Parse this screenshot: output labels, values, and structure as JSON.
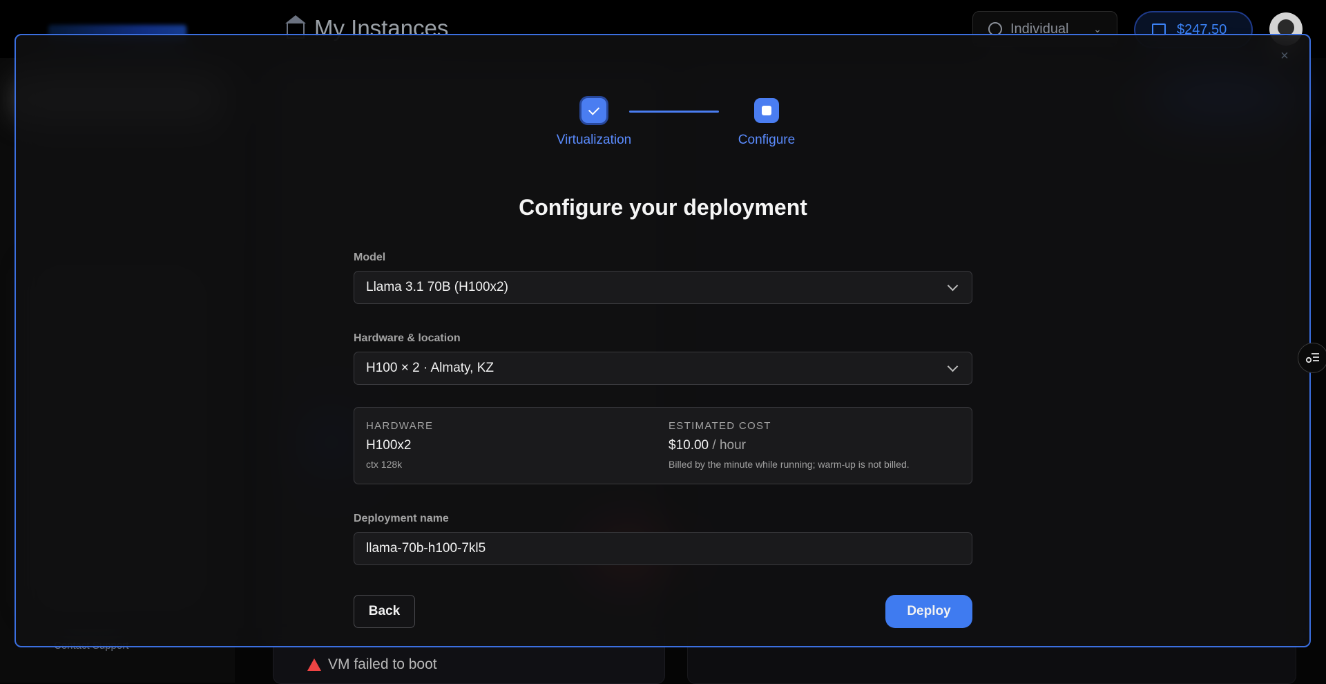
{
  "background": {
    "page_title": "My Instances",
    "account_selector": "Individual",
    "balance": "$247.50",
    "sidebar_footer_link": "Contact Support",
    "instance_error": "VM failed to boot"
  },
  "modal": {
    "close_label": "×",
    "steps": [
      {
        "label": "Virtualization",
        "state": "complete"
      },
      {
        "label": "Configure",
        "state": "current"
      }
    ],
    "heading": "Configure your deployment",
    "model": {
      "label": "Model",
      "value": "Llama 3.1 70B (H100x2)"
    },
    "hardware_location": {
      "label": "Hardware & location",
      "value": "H100 × 2 · Almaty, KZ"
    },
    "summary": {
      "hardware_kicker": "HARDWARE",
      "hardware_value": "H100x2",
      "hardware_sub": "ctx 128k",
      "cost_kicker": "ESTIMATED COST",
      "cost_value": "$10.00",
      "cost_unit": "/ hour",
      "cost_note": "Billed by the minute while running; warm-up is not billed."
    },
    "deployment_name": {
      "label": "Deployment name",
      "value": "llama-70b-h100-7kl5"
    },
    "back_label": "Back",
    "deploy_label": "Deploy"
  },
  "colors": {
    "accent": "#4a7df1",
    "modal_border": "#3b6fe0",
    "error": "#ef4444"
  },
  "icons": [
    "home-icon",
    "users-icon",
    "chevron-down-icon",
    "wallet-icon",
    "avatar",
    "close-icon",
    "check-icon",
    "step-square-icon",
    "checklist-icon",
    "warning-icon"
  ]
}
